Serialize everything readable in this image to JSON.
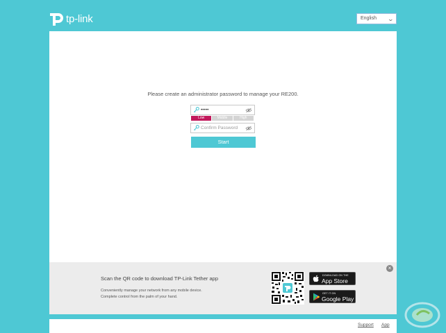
{
  "brand": {
    "name": "tp-link",
    "color": "#4ec8d4",
    "accent": "#c2185b"
  },
  "header": {
    "language": "English"
  },
  "setup": {
    "prompt": "Please create an administrator password to manage your RE200.",
    "password_value": "•••••",
    "strength": [
      "Low",
      "Middle",
      "High"
    ],
    "strength_active": "Low",
    "confirm_placeholder": "Confirm Password",
    "start_label": "Start"
  },
  "app_banner": {
    "title": "Scan the QR code to download TP-Link Tether app",
    "line1": "Conveniently manage your network from any mobile device.",
    "line2": "Complete control from the palm of your hand.",
    "app_store_small": "DOWNLOAD ON THE",
    "app_store_big": "App Store",
    "google_small": "GET IT ON",
    "google_big": "Google Play"
  },
  "footer": {
    "support": "Support",
    "app": "App"
  },
  "icons": [
    "tp-link-logo-icon",
    "key-icon",
    "eye-icon",
    "qr-code",
    "apple-icon",
    "google-play-icon",
    "close-icon"
  ]
}
